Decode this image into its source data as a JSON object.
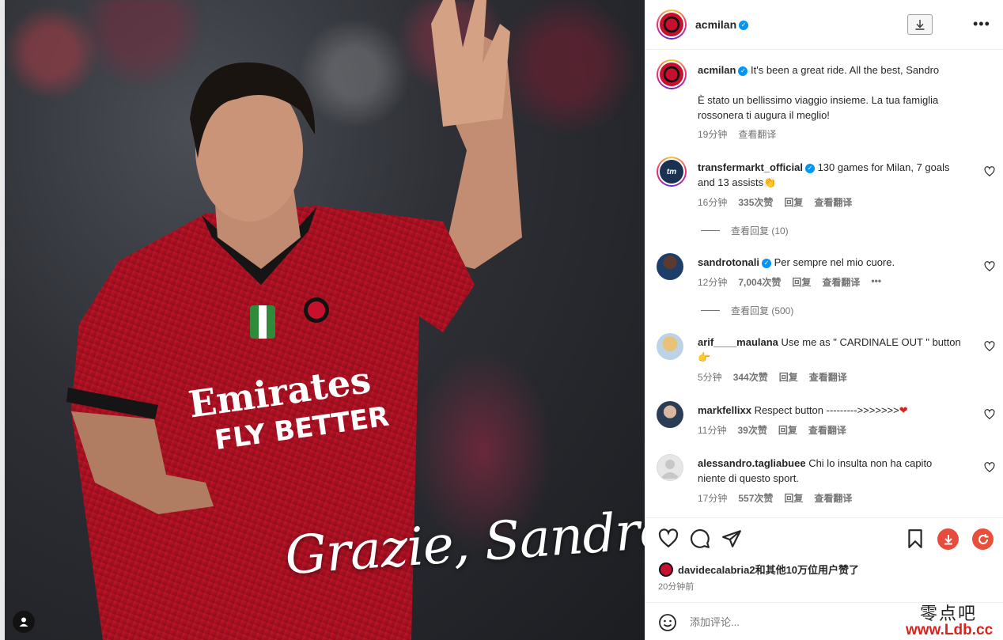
{
  "post": {
    "username": "acmilan",
    "overlay_text": "Grazie, Sandro"
  },
  "caption": {
    "username": "acmilan",
    "text_line1": "It's been a great ride. All the best, Sandro",
    "text_line2": "È stato un bellissimo viaggio insieme. La tua famiglia",
    "text_line3": "rossonera ti augura il meglio!",
    "time": "19分钟",
    "translate": "查看翻译"
  },
  "comments": [
    {
      "username": "transfermarkt_official",
      "verified": true,
      "text_a": "130 games for Milan, 7 goals",
      "text_b": "and 13 assists👏",
      "time": "16分钟",
      "likes": "335次赞",
      "reply": "回复",
      "translate": "查看翻译",
      "view_replies": "查看回复 (10)"
    },
    {
      "username": "sandrotonali",
      "verified": true,
      "text_a": "Per sempre nel mio cuore.",
      "time": "12分钟",
      "likes": "7,004次赞",
      "reply": "回复",
      "translate": "查看翻译",
      "view_replies": "查看回复 (500)"
    },
    {
      "username": "arif____maulana",
      "text_a": "Use me as \" CARDINALE OUT \" button",
      "text_b": "👉",
      "time": "5分钟",
      "likes": "344次赞",
      "reply": "回复",
      "translate": "查看翻译"
    },
    {
      "username": "markfellixx",
      "text_a": "Respect button --------->>>>>>>",
      "time": "11分钟",
      "likes": "39次赞",
      "reply": "回复",
      "translate": "查看翻译"
    },
    {
      "username": "alessandro.tagliabuee",
      "text_a": "Chi lo insulta non ha capito",
      "text_b": "niente di questo sport.",
      "time": "17分钟",
      "likes": "557次赞",
      "reply": "回复",
      "translate": "查看翻译"
    }
  ],
  "likes_line": {
    "user": "davidecalabria2",
    "rest": "和其他10万位用户赞了"
  },
  "posted_ago": "20分钟前",
  "add_comment_placeholder": "添加评论...",
  "watermark": {
    "line1": "零点吧",
    "line2": "www.Ldb.cc"
  },
  "colors": {
    "verified": "#0095f6",
    "milan_red": "#c8102e",
    "download_red": "#e84a3c",
    "refresh_red": "#e8503a"
  }
}
